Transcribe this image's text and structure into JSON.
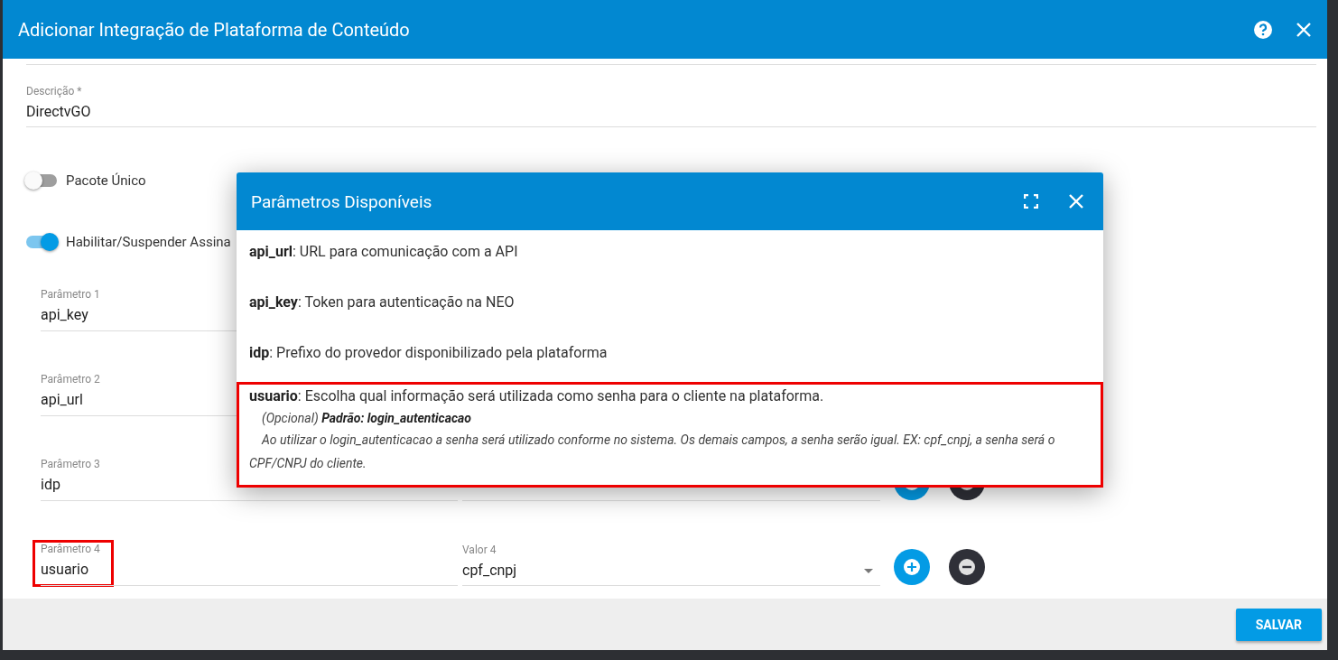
{
  "dialog": {
    "title": "Adicionar Integração de Plataforma de Conteúdo",
    "description": {
      "label": "Descrição *",
      "value": "DirectvGO"
    },
    "toggles": [
      {
        "label": "Pacote Único",
        "on": false
      },
      {
        "label": "Habilitar/Suspender Assina",
        "on": true
      }
    ],
    "parameters": [
      {
        "label": "Parâmetro 1",
        "value": "api_key",
        "highlighted": false
      },
      {
        "label": "Parâmetro 2",
        "value": "api_url",
        "highlighted": false
      },
      {
        "label": "Parâmetro 3",
        "value": "idp",
        "highlighted": false,
        "actions": true
      },
      {
        "label": "Parâmetro 4",
        "value": "usuario",
        "highlighted": true,
        "actions": true,
        "valor": {
          "label": "Valor 4",
          "value": "cpf_cnpj"
        }
      }
    ],
    "save_button": "SALVAR"
  },
  "modal": {
    "title": "Parâmetros Disponíveis",
    "items": [
      {
        "text": "**api_url**: URL para comunicação com a API",
        "highlighted": false
      },
      {
        "text": "**api_key**: Token para autenticação na NEO",
        "highlighted": false
      },
      {
        "text": "**idp**: Prefixo do provedor disponibilizado pela plataforma",
        "highlighted": false
      },
      {
        "text": "**usuario**: Escolha qual informação será utilizada como senha para o cliente na plataforma.",
        "highlighted": true,
        "note": "(Opcional) **Padrão: login_autenticacao**",
        "detail": "Ao utilizar o login_autenticacao a senha será utilizado conforme no sistema. Os demais campos, a senha serão igual. EX: cpf_cnpj, a senha será o CPF/CNPJ do cliente."
      }
    ]
  }
}
